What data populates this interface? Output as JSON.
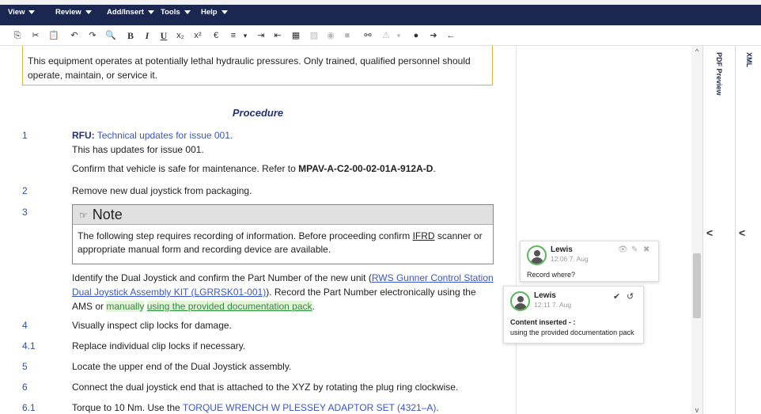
{
  "menu": [
    "View",
    "Review",
    "Add/Insert",
    "Tools",
    "Help"
  ],
  "toolbar": {
    "copy": "⎘",
    "cut": "✂",
    "paste": "📋",
    "undo": "↶",
    "redo": "↷",
    "find": "🔍",
    "bold": "B",
    "italic": "I",
    "underline": "U",
    "subscript": "x₂",
    "superscript": "x²",
    "euro": "€",
    "list": "≡",
    "list_caret": "▾",
    "indent": "⇥",
    "outdent": "⇤",
    "table": "▦",
    "image": "▨",
    "camera": "◉",
    "video": "■",
    "link": "⚯",
    "warning": "⚠",
    "warning_caret": "▾",
    "comment": "●",
    "next": "➔",
    "prev": "←"
  },
  "doc": {
    "warning_text": "This equipment operates at potentially lethal hydraulic pressures. Only trained, qualified personnel should operate, maintain, or service it.",
    "procedure_title": "Procedure",
    "steps": {
      "s1_num": "1",
      "s1_rfu_label": "RFU:",
      "s1_rfu_link": "Technical updates for issue 001.",
      "s1_rfu_desc": "This has updates for issue 001.",
      "s1_confirm_pre": "Confirm that vehicle is safe for maintenance. Refer to ",
      "s1_confirm_ref": "MPAV-A-C2-00-02-01A-912A-D",
      "s1_confirm_post": ".",
      "s2_num": "2",
      "s2_text": "Remove new dual joystick from packaging.",
      "s3_num": "3",
      "note_title": "Note",
      "note_pre": "The following step requires recording of information. Before proceeding confirm ",
      "note_abbr": "IFRD",
      "note_post": " scanner or appropriate manual form and recording device are available.",
      "s3_pre": "Identify the Dual Joystick and confirm the Part Number of the new unit (",
      "s3_link": "RWS Gunner Control Station Dual Joystick Assembly KIT (LGRRSK01-001)",
      "s3_mid": "). Record the Part Number electronically using the AMS or ",
      "s3_hl1": "manually",
      "s3_hl2": "using the provided documentation pack",
      "s3_end": ".",
      "s4_num": "4",
      "s4_text": "Visually inspect clip locks for damage.",
      "s41_num": "4.1",
      "s41_text": "Replace individual clip locks if necessary.",
      "s5_num": "5",
      "s5_text": "Locate the upper end of the Dual Joystick assembly.",
      "s6_num": "6",
      "s6_text": "Connect the dual joystick end that is attached to the XYZ by rotating the plug ring clockwise.",
      "s61_num": "6.1",
      "s61_pre": "Torque to 10 Nm. Use the ",
      "s61_link": "TORQUE WRENCH W PLESSEY ADAPTOR SET (4321–A)",
      "s61_end": "."
    }
  },
  "comments": [
    {
      "author": "Lewis",
      "time": "12:06 7. Aug",
      "text": "Record where?"
    },
    {
      "author": "Lewis",
      "time": "12:11 7. Aug",
      "label": "Content inserted - :",
      "text": "using the provided documentation pack"
    }
  ],
  "comment_icons": {
    "view": "👁",
    "edit": "✎",
    "delete": "✖",
    "accept": "✔",
    "reject": "↺"
  },
  "scroll": {
    "up": "^",
    "down": "v"
  },
  "panels": {
    "pdf_label": "PDF Preview",
    "xml_label": "XML",
    "collapse": "<"
  },
  "colors": {
    "menubar": "#1c2751",
    "warning_border": "#e3b341",
    "link": "#3a56c8",
    "avatar_ring": "#5cb85c"
  }
}
